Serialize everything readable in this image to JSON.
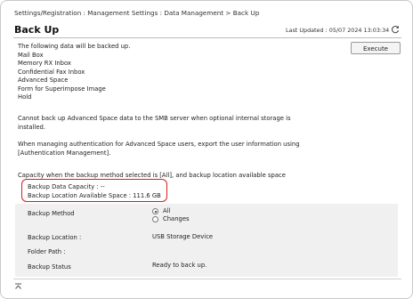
{
  "breadcrumb": "Settings/Registration : Management Settings : Data Management > Back Up",
  "title": "Back Up",
  "last_updated": "Last Updated : 05/07 2024 13:03:34",
  "execute_label": "Execute",
  "intro": "The following data will be backed up.",
  "backup_items": [
    "Mail Box",
    "Memory RX Inbox",
    "Confidential Fax Inbox",
    "Advanced Space",
    "Form for Superimpose Image",
    "Hold"
  ],
  "note_smb": "Cannot back up Advanced Space data to the SMB server when optional internal storage is installed.",
  "note_auth": "When managing authentication for Advanced Space users, export the user information using [Authentication Management].",
  "capacity_heading": "Capacity when the backup method selected is [All], and backup location available space",
  "capacity": {
    "data_capacity": "Backup Data Capacity : --",
    "available_space": "Backup Location Available Space : 111.6 GB"
  },
  "settings": {
    "method_label": "Backup Method",
    "method_options": [
      "All",
      "Changes"
    ],
    "method_selected": "All",
    "location_label": "Backup Location :",
    "location_value": "USB Storage Device",
    "folder_label": "Folder Path :",
    "folder_value": "",
    "status_label": "Backup Status",
    "status_value": "Ready to back up."
  },
  "icons": {
    "refresh": "refresh-icon",
    "scroll_top": "scroll-to-top-icon"
  },
  "colors": {
    "highlight": "#d62020",
    "panel_bg": "#f0f0f0"
  }
}
